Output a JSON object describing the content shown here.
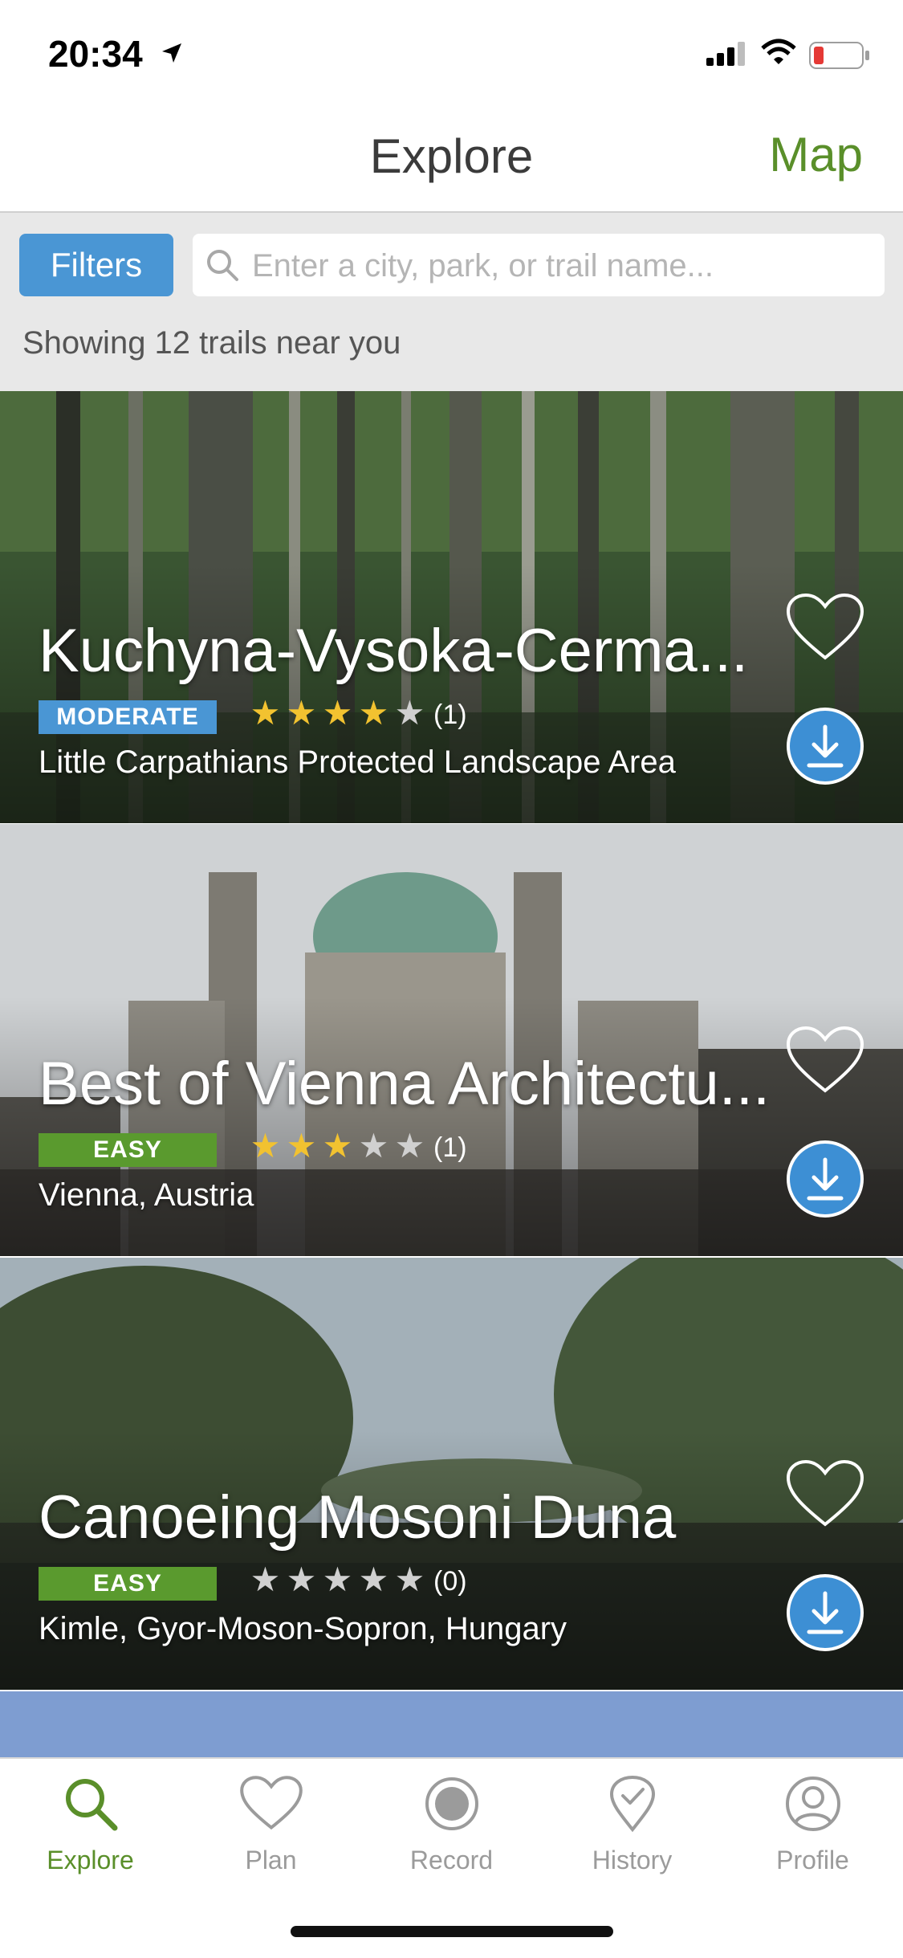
{
  "status_bar": {
    "time": "20:34"
  },
  "nav": {
    "title": "Explore",
    "map_label": "Map"
  },
  "search": {
    "filters_label": "Filters",
    "placeholder": "Enter a city, park, or trail name...",
    "showing_text": "Showing 12 trails near you"
  },
  "trails": [
    {
      "name": "Kuchyna-Vysoka-Cerma...",
      "difficulty": "MODERATE",
      "rating": 4,
      "rating_count": "(1)",
      "location": "Little Carpathians Protected Landscape Area",
      "difficulty_color": "#4a96d4"
    },
    {
      "name": "Best of Vienna Architectu...",
      "difficulty": "EASY",
      "rating": 3,
      "rating_count": "(1)",
      "location": "Vienna, Austria",
      "difficulty_color": "#5a9a2e"
    },
    {
      "name": "Canoeing Mosoni Duna",
      "difficulty": "EASY",
      "rating": 0,
      "rating_count": "(0)",
      "location": "Kimle, Gyor-Moson-Sopron, Hungary",
      "difficulty_color": "#5a9a2e"
    }
  ],
  "tabs": [
    {
      "label": "Explore",
      "icon": "search-icon",
      "active": true
    },
    {
      "label": "Plan",
      "icon": "heart-icon",
      "active": false
    },
    {
      "label": "Record",
      "icon": "record-icon",
      "active": false
    },
    {
      "label": "History",
      "icon": "history-pin-icon",
      "active": false
    },
    {
      "label": "Profile",
      "icon": "profile-icon",
      "active": false
    }
  ],
  "colors": {
    "accent_green": "#5a8f2a",
    "accent_blue": "#4a96d4",
    "star_on": "#f2c230"
  }
}
